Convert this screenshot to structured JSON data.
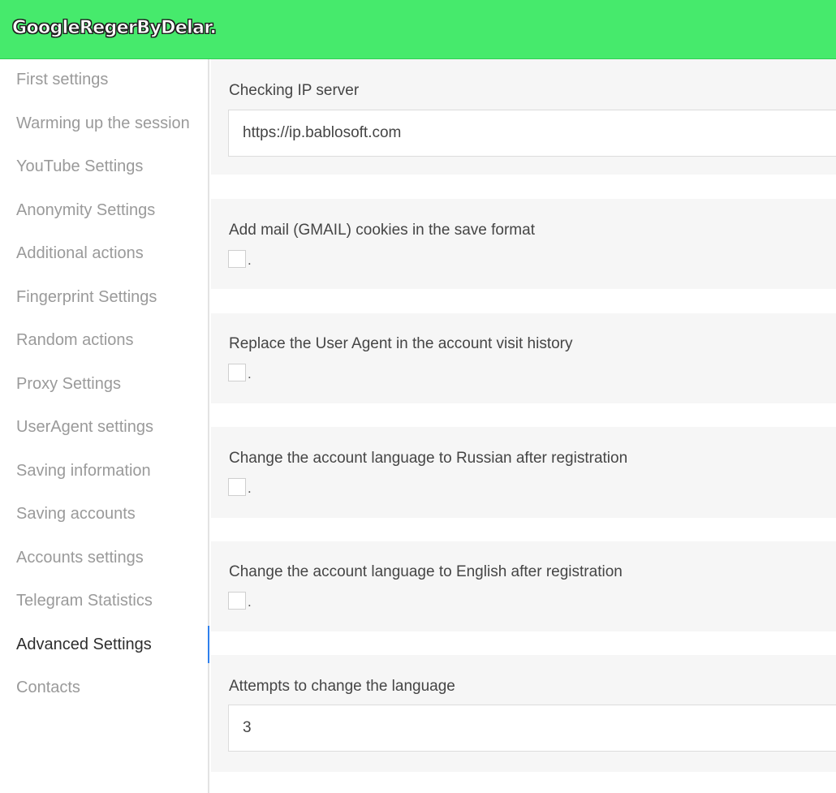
{
  "header": {
    "title": "GoogleRegerByDelar.",
    "background": "#46ea6c"
  },
  "sidebar": {
    "items": [
      {
        "label": "First settings"
      },
      {
        "label": "Warming up the session"
      },
      {
        "label": "YouTube Settings"
      },
      {
        "label": "Anonymity Settings"
      },
      {
        "label": "Additional actions"
      },
      {
        "label": "Fingerprint Settings"
      },
      {
        "label": "Random actions"
      },
      {
        "label": "Proxy Settings"
      },
      {
        "label": "UserAgent settings"
      },
      {
        "label": "Saving information"
      },
      {
        "label": "Saving accounts"
      },
      {
        "label": "Accounts settings"
      },
      {
        "label": "Telegram Statistics"
      },
      {
        "label": "Advanced Settings",
        "active": true
      },
      {
        "label": "Contacts"
      }
    ],
    "active_color": "#2f80ed"
  },
  "main": {
    "checking_ip": {
      "label": "Checking IP server",
      "value": "https://ip.bablosoft.com"
    },
    "gmail_cookies": {
      "label": "Add mail (GMAIL) cookies in the save format",
      "checked": false,
      "suffix": "."
    },
    "replace_user_agent": {
      "label": "Replace the User Agent in the account visit history",
      "checked": false,
      "suffix": "."
    },
    "lang_russian": {
      "label": "Change the account language to Russian after registration",
      "checked": false,
      "suffix": "."
    },
    "lang_english": {
      "label": "Change the account language to English after registration",
      "checked": false,
      "suffix": "."
    },
    "lang_attempts": {
      "label": "Attempts to change the language",
      "value": "3"
    }
  }
}
